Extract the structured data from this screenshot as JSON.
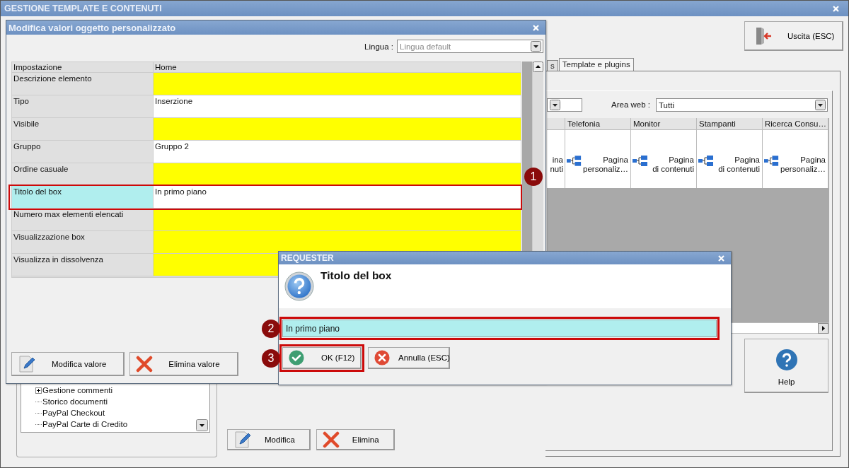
{
  "window": {
    "title": "GESTIONE TEMPLATE E CONTENUTI"
  },
  "exit_button": {
    "label": "Uscita (ESC)"
  },
  "tabs": [
    {
      "label": "s",
      "selected": false
    },
    {
      "label": "Template e plugins",
      "selected": true
    }
  ],
  "filters": {
    "area_label": "Area web :",
    "area_value": "Tutti"
  },
  "grid": {
    "partial_column": {
      "line_1": "ina",
      "line_2": "nuti"
    },
    "columns": [
      {
        "header": "Telefonia",
        "line_1": "Pagina",
        "line_2": "personaliz…"
      },
      {
        "header": "Monitor",
        "line_1": "Pagina",
        "line_2": "di contenuti"
      },
      {
        "header": "Stampanti",
        "line_1": "Pagina",
        "line_2": "di contenuti"
      },
      {
        "header": "Ricerca Consu…",
        "line_1": "Pagina",
        "line_2": "personaliz…"
      }
    ]
  },
  "help_button": {
    "label": "Help"
  },
  "tree": {
    "items": [
      {
        "label": "Gestione commenti",
        "kind": "collapsed"
      },
      {
        "label": "Storico documenti",
        "kind": "leaf"
      },
      {
        "label": "PayPal Checkout",
        "kind": "leaf"
      },
      {
        "label": "PayPal Carte di Credito",
        "kind": "leaf"
      }
    ]
  },
  "buttons": [
    {
      "label": "Modifica",
      "kind": "edit"
    },
    {
      "label": "Elimina",
      "kind": "delete"
    }
  ],
  "editor_dialog": {
    "title": "Modifica valori oggetto personalizzato",
    "language_label": "Lingua :",
    "language_value": "Lingua default",
    "language_disabled": true,
    "columns": [
      "Impostazione",
      "Home"
    ],
    "rows": [
      {
        "setting": "Descrizione elemento",
        "highlighted": true,
        "selected": false
      },
      {
        "setting": "Tipo",
        "value": "Inserzione",
        "highlighted": false,
        "selected": false
      },
      {
        "setting": "Visibile",
        "highlighted": true,
        "selected": false
      },
      {
        "setting": "Gruppo",
        "value": "Gruppo 2",
        "highlighted": false,
        "selected": false
      },
      {
        "setting": "Ordine casuale",
        "highlighted": true,
        "selected": false
      },
      {
        "setting": "Titolo del box",
        "value": "In primo piano",
        "highlighted": false,
        "selected": true
      },
      {
        "setting": "Numero max elementi elencati",
        "highlighted": true,
        "selected": false
      },
      {
        "setting": "Visualizzazione box",
        "highlighted": true,
        "selected": false
      },
      {
        "setting": "Visualizza in dissolvenza",
        "highlighted": true,
        "selected": false
      }
    ],
    "buttons": [
      {
        "label": "Modifica valore",
        "kind": "edit"
      },
      {
        "label": "Elimina valore",
        "kind": "delete"
      }
    ]
  },
  "requester": {
    "title": "REQUESTER",
    "heading": "Titolo del box",
    "value": "In primo piano",
    "buttons": [
      {
        "label": "OK (F12)",
        "kind": "ok"
      },
      {
        "label": "Annulla (ESC)",
        "kind": "cancel"
      }
    ]
  },
  "annotations": {
    "row": "1",
    "input": "2",
    "ok_button": "3"
  }
}
